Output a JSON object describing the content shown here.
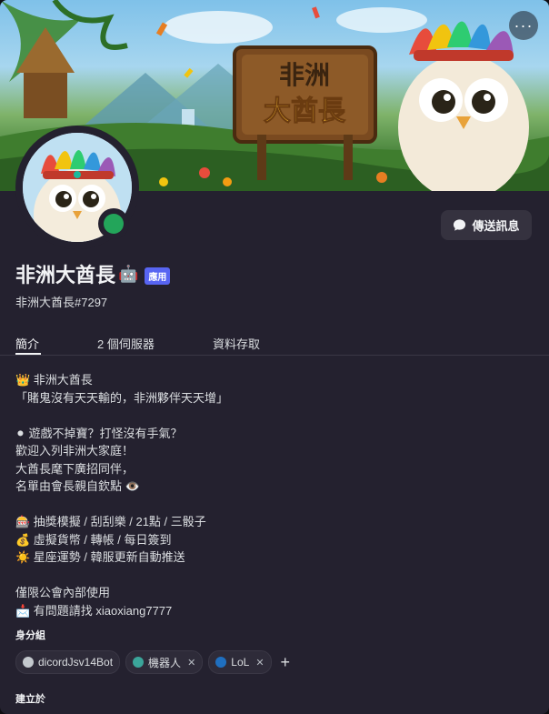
{
  "banner": {
    "sign_line1": "非洲",
    "sign_line2": "大酋長",
    "more_label": "···"
  },
  "profile": {
    "display_name": "非洲大酋長",
    "bot_emoji": "🤖",
    "badge": "應用",
    "username": "非洲大酋長#7297",
    "message_button": "傳送訊息",
    "status": "online"
  },
  "tabs": [
    {
      "label": "簡介",
      "active": true
    },
    {
      "label": "2 個伺服器",
      "active": false
    },
    {
      "label": "資料存取",
      "active": false
    }
  ],
  "bio": {
    "text": "👑 非洲大酋長\n「賭鬼沒有天天輸的，非洲夥伴天天增」\n\n⚫ 遊戲不掉寶？打怪沒有手氣？\n歡迎入列非洲大家庭！\n大酋長麾下廣招同伴，\n名單由會長親自欽點 👁️\n\n🎰 抽獎模擬 / 刮刮樂 / 21點 / 三骰子\n💰 虛擬貨幣 / 轉帳 / 每日簽到\n☀️ 星座運勢 / 韓服更新自動推送\n\n僅限公會內部使用\n📩 有問題請找 xiaoxiang7777"
  },
  "roles_section": {
    "title": "身分組",
    "roles": [
      {
        "name": "dicordJsv14Bot",
        "color": "#c4c9ce",
        "removable": false
      },
      {
        "name": "機器人",
        "color": "#3ba59a",
        "removable": true
      },
      {
        "name": "LoL",
        "color": "#1f6fbf",
        "removable": true
      }
    ],
    "add_label": "+"
  },
  "created_section": {
    "title": "建立於"
  }
}
